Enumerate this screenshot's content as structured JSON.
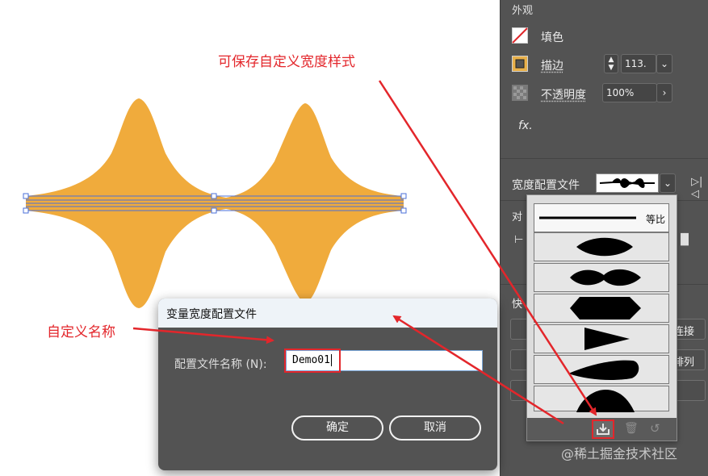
{
  "panel": {
    "section_title": "外观",
    "fill_label": "填色",
    "stroke_label": "描边",
    "stroke_weight_value": "113.",
    "opacity_label": "不透明度",
    "opacity_value": "100%",
    "fx_label": "fx.",
    "width_profile_label": "宽度配置文件",
    "align_label_partial": "对",
    "section_partial_label": "快",
    "btn_partial_1": "连接",
    "btn_partial_2": "排列"
  },
  "profile_list": {
    "uniform_label": "等比",
    "items": [
      "uniform",
      "width-profile-1",
      "width-profile-2",
      "width-profile-3",
      "width-profile-4",
      "width-profile-5",
      "width-profile-6"
    ]
  },
  "dialog": {
    "title": "变量宽度配置文件",
    "field_label": "配置文件名称 (N):",
    "name_value": "Demo01",
    "ok_label": "确定",
    "cancel_label": "取消"
  },
  "annotations": {
    "save_hint": "可保存自定义宽度样式",
    "name_hint": "自定义名称"
  },
  "watermark": "@稀土掘金技术社区",
  "colors": {
    "shape_fill": "#f0ab3c",
    "panel_bg": "#535353",
    "annotation_red": "#e3262b",
    "selection_blue": "#4a6fd8",
    "stroke_swatch": "#e8b04a"
  }
}
